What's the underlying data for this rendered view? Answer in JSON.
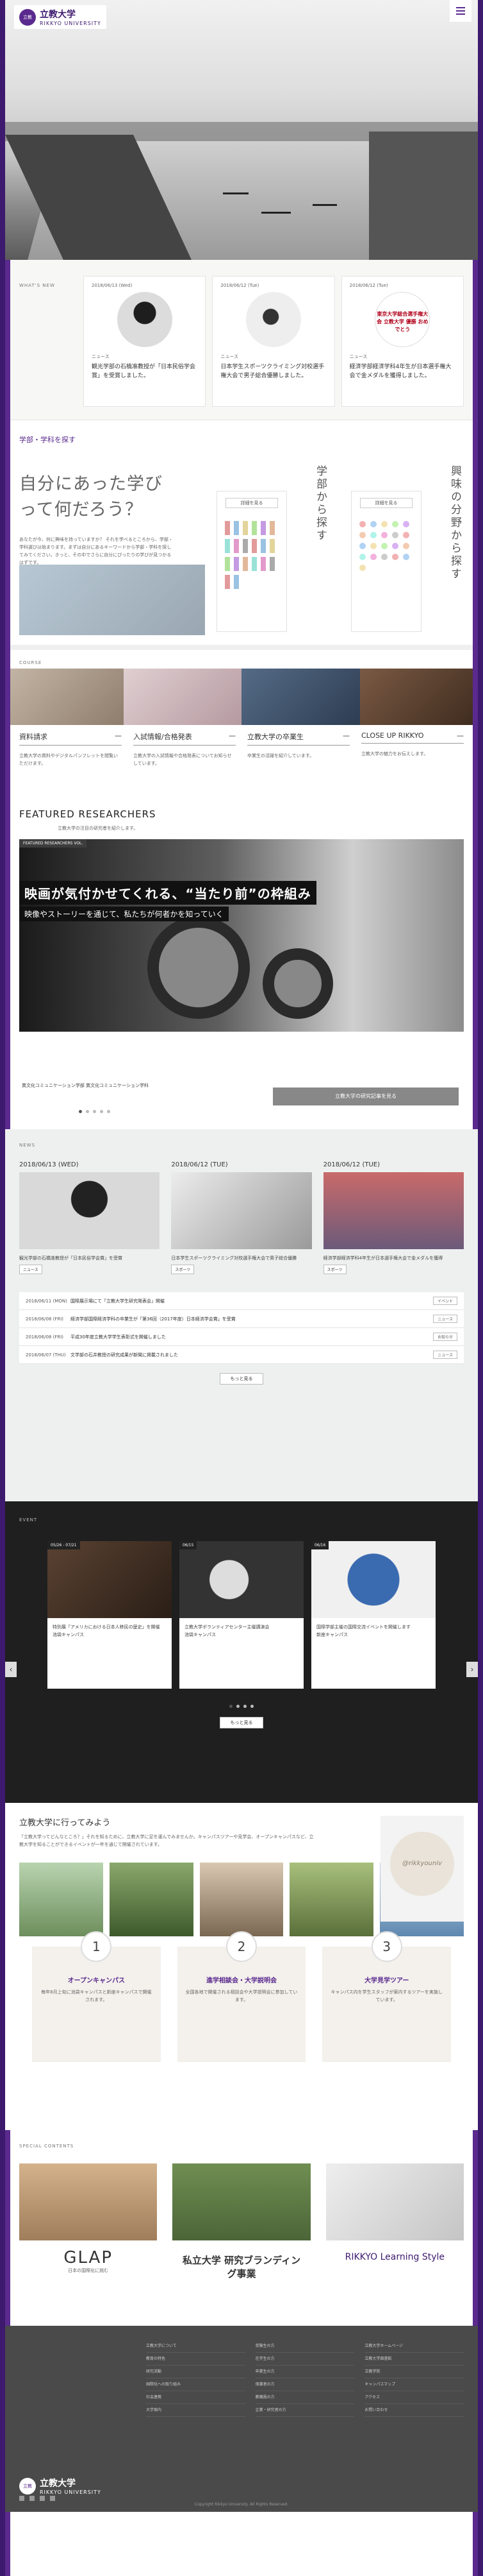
{
  "header": {
    "logo_ja": "立教大学",
    "logo_en": "RIKKYO UNIVERSITY",
    "seal": "立教"
  },
  "whatsnew": {
    "label": "WHAT'S NEW",
    "items": [
      {
        "date": "2018/06/13 (Wed)",
        "tag": "ニュース",
        "title": "観光学部の石橋准教授が「日本民俗学会賞」を受賞しました。"
      },
      {
        "date": "2018/06/12 (Tue)",
        "tag": "ニュース",
        "title": "日本学生スポーツクライミング対校選手権大会で男子総合優勝しました。"
      },
      {
        "date": "2018/06/12 (Tue)",
        "tag": "ニュース",
        "title": "経済学部経済学科4年生が日本選手権大会で金メダルを獲得しました。",
        "image_text": "東京大学総合選手権大会 立教大学 優勝 おめでとう"
      }
    ]
  },
  "dept": {
    "head": "学部・学科を探す",
    "big": "自分にあった学びって何だろう？",
    "note": "あなたが今、何に興味を持っていますか？ それを学べるところから、学部・学科選びは始まります。まずは自分にあるキーワードから学部・学科を探してみてください。きっと、その中でさらに自分にぴったりの学びが見つかるはずです。",
    "vert1": "学部から探す",
    "vert2": "興味の分野から探す",
    "btn": "詳細を見る"
  },
  "course": {
    "label": "COURSE",
    "items": [
      {
        "title": "資料請求",
        "text": "立教大学の資料やデジタルパンフレットを閲覧いただけます。"
      },
      {
        "title": "入試情報/合格発表",
        "text": "立教大学の入試情報や合格発表についてお知らせしています。"
      },
      {
        "title": "立教大学の卒業生",
        "text": "卒業生の活躍を紹介しています。"
      },
      {
        "title": "CLOSE UP RIKKYO",
        "text": "立教大学の魅力をお伝えします。"
      }
    ]
  },
  "fr": {
    "title": "FEATURED RESEARCHERS",
    "sub": "立教大学の注目の研究者を紹介します。",
    "tag": "FEATURED RESEARCHERS VOL.",
    "caption": "映画が気付かせてくれる、“当たり前”の枠組み",
    "caption2": "映像やストーリーを通じて、私たちが何者かを知っていく",
    "info": "異文化コミュニケーション学部 異文化コミュニケーション学科",
    "btn": "立教大学の研究記事を見る"
  },
  "news": {
    "label": "NEWS",
    "cards": [
      {
        "date": "2018/06/13 (WED)",
        "text": "観光学部の石橋准教授が「日本民俗学会賞」を受賞",
        "tag": "ニュース"
      },
      {
        "date": "2018/06/12 (TUE)",
        "text": "日本学生スポーツクライミング対校選手権大会で男子総合優勝",
        "tag": "スポーツ"
      },
      {
        "date": "2018/06/12 (TUE)",
        "text": "経済学部経済学科4年生が日本選手権大会で金メダルを獲得",
        "tag": "スポーツ"
      }
    ],
    "rows": [
      {
        "d": "2018/06/11 (MON)",
        "t": "国際展示場にて「立教大学生研究発表会」開催",
        "c": "イベント"
      },
      {
        "d": "2018/06/08 (FRI)",
        "t": "経済学部国際経済学科の卒業生が「第36回（2017年度）日本経済学会賞」を受賞",
        "c": "ニュース"
      },
      {
        "d": "2018/06/08 (FRI)",
        "t": "平成30年度立教大学学生表彰式を開催しました",
        "c": "お知らせ"
      },
      {
        "d": "2018/06/07 (THU)",
        "t": "文学部の石井教授の研究成果が新聞に掲載されました",
        "c": "ニュース"
      }
    ],
    "more": "もっと見る"
  },
  "events": {
    "label": "EVENT",
    "cards": [
      {
        "badge": "05/26 - 07/21",
        "text": "特別展「アメリカにおける日本人移民の歴史」を開催",
        "place": "池袋キャンパス"
      },
      {
        "badge": "06/15",
        "text": "立教大学ボランティアセンター主催講演会",
        "place": "池袋キャンパス"
      },
      {
        "badge": "06/16",
        "text": "国際学部主催の国際交流イベントを開催します",
        "place": "新座キャンパス"
      }
    ],
    "more": "もっと見る"
  },
  "life": {
    "title": "立教大学に行ってみよう",
    "text": "「立教大学ってどんなところ？」それを知るために、立教大学に足を運んでみませんか。キャンパスツアーや見学会、オープンキャンパスなど、立教大学を知ることができるイベントが一年を通じて開催されています。",
    "insta": "@rikkyouniv",
    "cards": [
      {
        "num": "1",
        "title": "オープンキャンパス",
        "text": "毎年8月上旬に池袋キャンパスと新座キャンパスで開催されます。"
      },
      {
        "num": "2",
        "title": "進学相談会・大学説明会",
        "text": "全国各地で開催される相談会や大学説明会に参加しています。"
      },
      {
        "num": "3",
        "title": "大学見学ツアー",
        "text": "キャンパス内を学生スタッフが案内するツアーを実施しています。"
      }
    ]
  },
  "special": {
    "label": "SPECIAL CONTENTS",
    "cards": [
      {
        "logo": "GLAP",
        "sub": "日本の国際化に挑む"
      },
      {
        "logo": "私立大学 研究ブランディング事業",
        "sub": ""
      },
      {
        "logo": "RIKKYO Learning Style",
        "sub": ""
      }
    ]
  },
  "footer": {
    "cols": [
      [
        "立教大学について",
        "教育の特色",
        "研究活動",
        "国際化への取り組み",
        "社会連携",
        "大学案内"
      ],
      [
        "受験生の方",
        "在学生の方",
        "卒業生の方",
        "保護者の方",
        "教職員の方",
        "企業・研究者の方"
      ],
      [
        "立教大学ホームページ",
        "立教大学図書館",
        "立教学院",
        "キャンパスマップ",
        "アクセス",
        "お問い合わせ"
      ]
    ],
    "logo_ja": "立教大学",
    "logo_en": "RIKKYO UNIVERSITY",
    "copy": "Copyright Rikkyo University. All Rights Reserved."
  }
}
